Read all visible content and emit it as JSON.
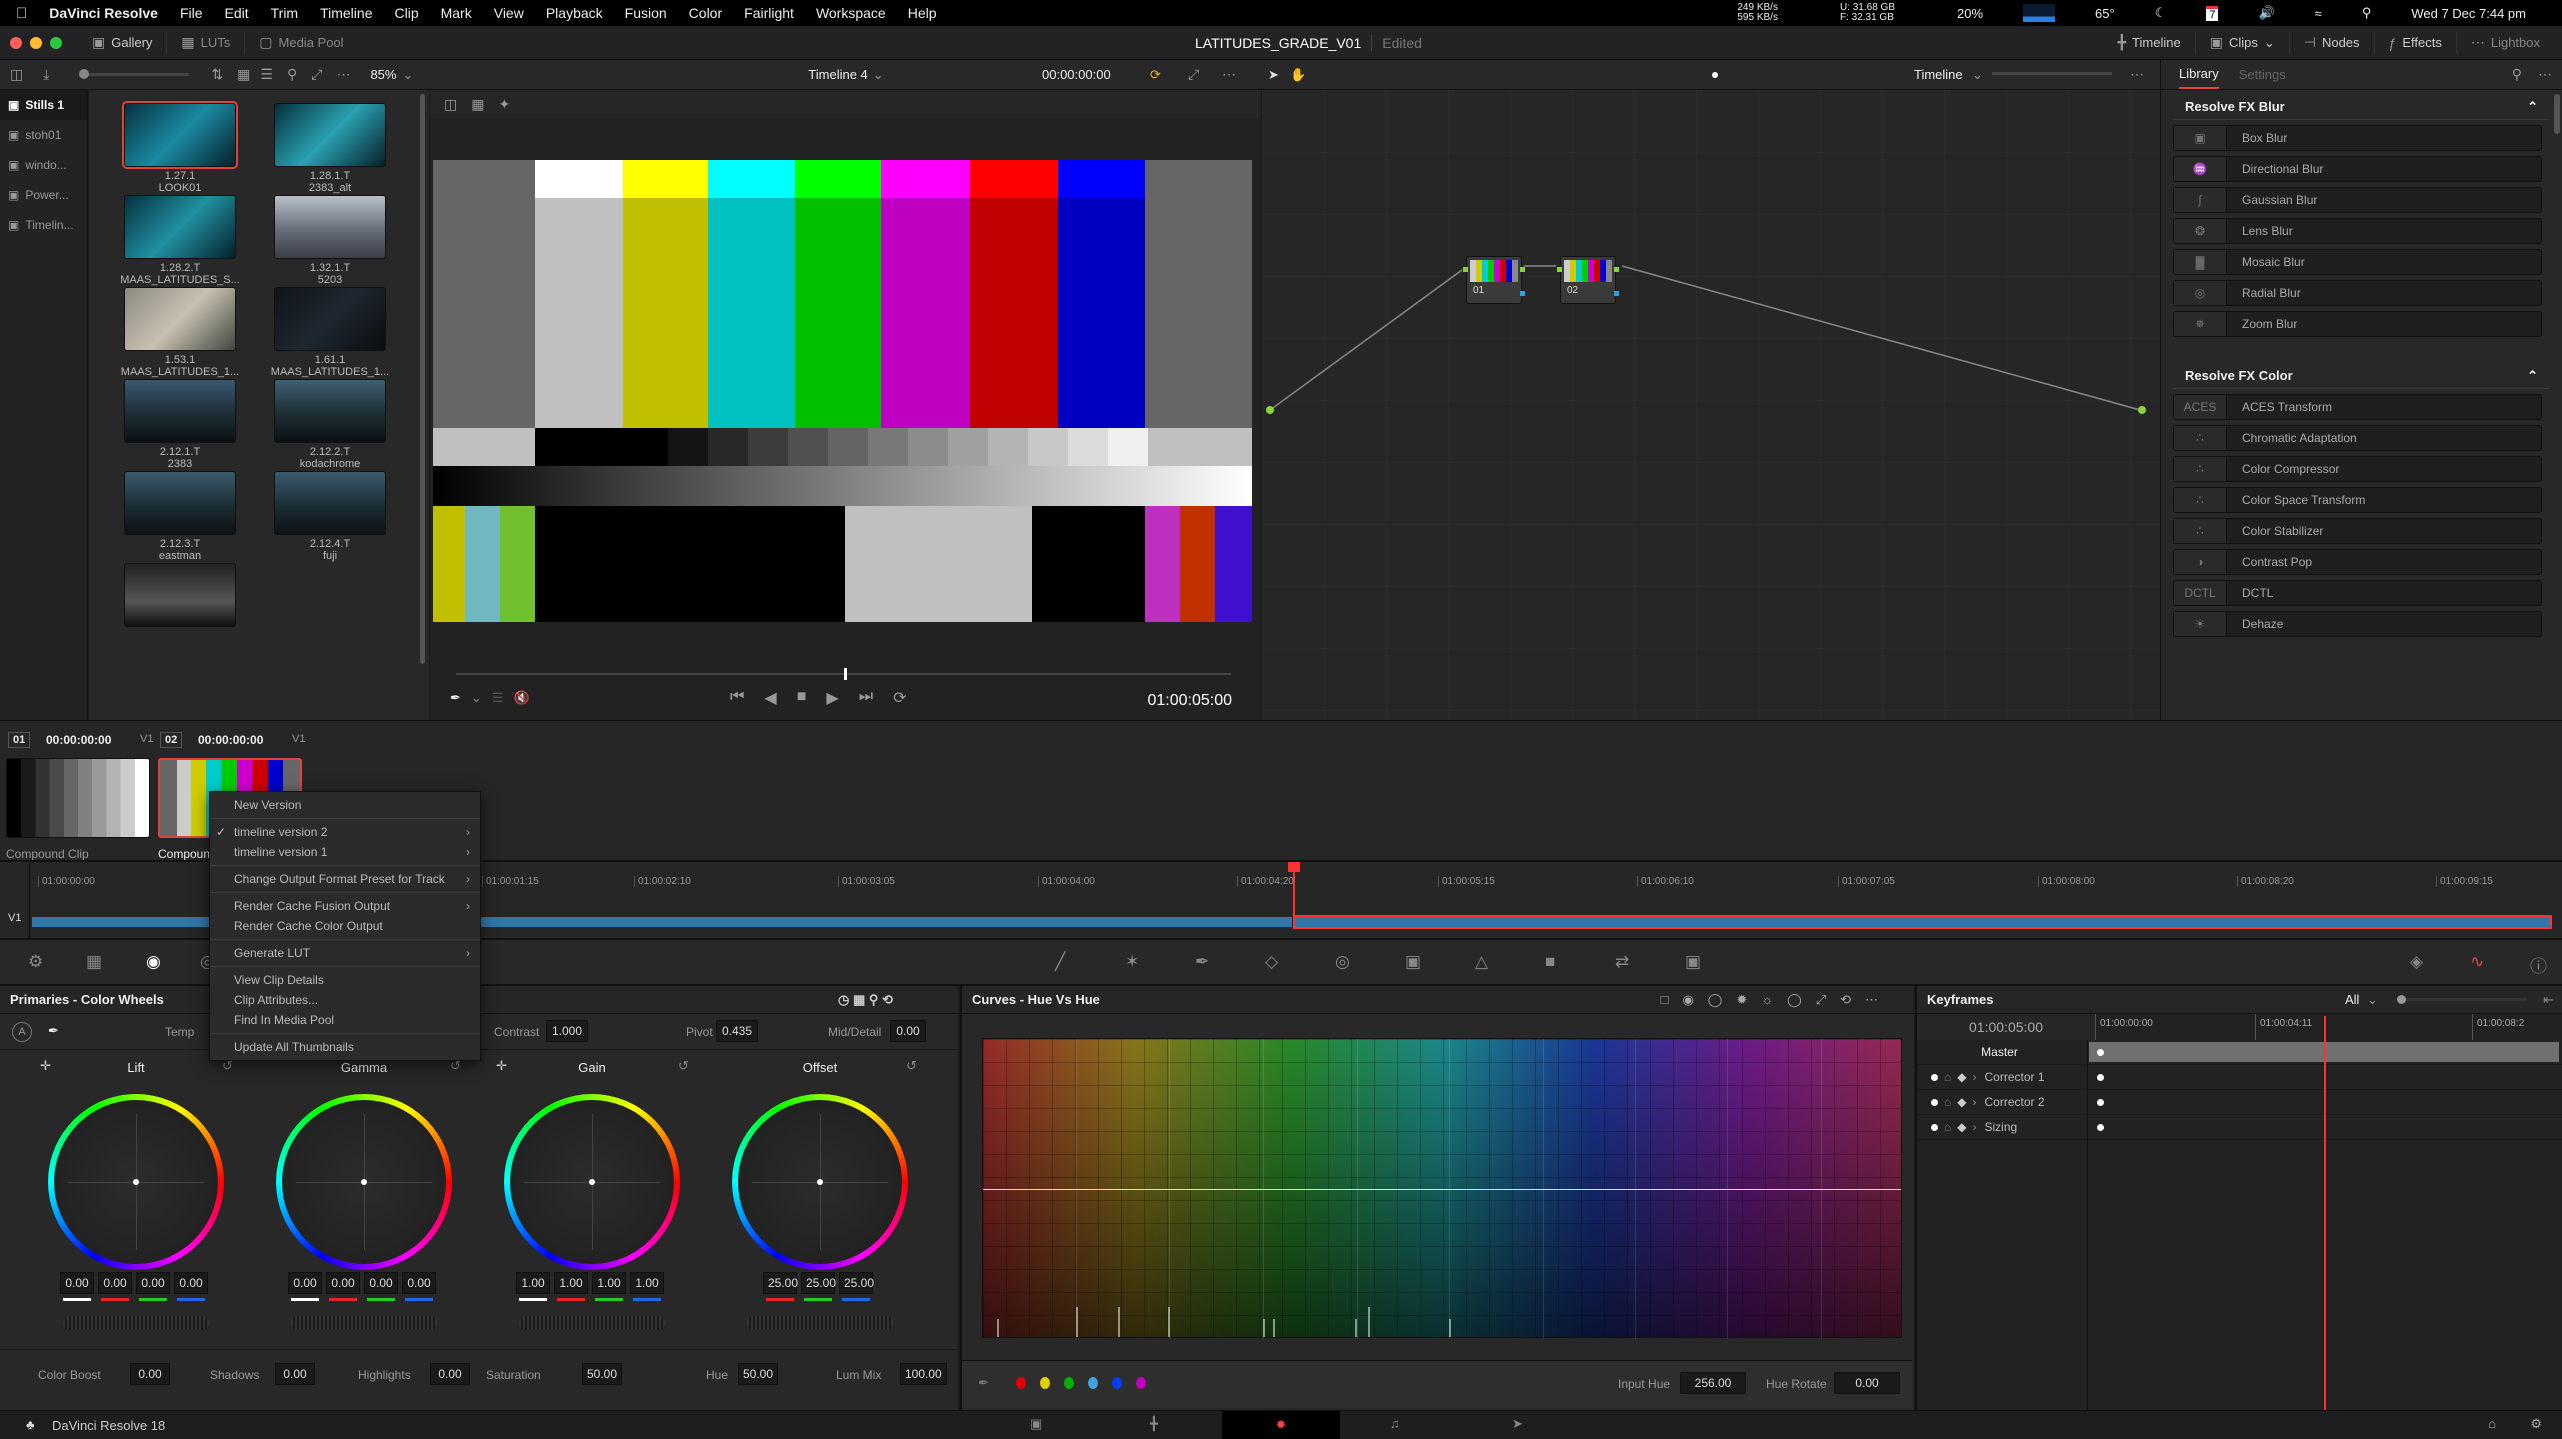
{
  "menubar": {
    "app": "DaVinci Resolve",
    "items": [
      "File",
      "Edit",
      "Trim",
      "Timeline",
      "Clip",
      "Mark",
      "View",
      "Playback",
      "Fusion",
      "Color",
      "Fairlight",
      "Workspace",
      "Help"
    ],
    "status": {
      "net_up": "249 KB/s",
      "net_down": "595 KB/s",
      "disk_u": "U: 31.68 GB",
      "disk_f": "F: 32.31 GB",
      "cpu": "20%",
      "temp": "65°",
      "calendar_day": "7",
      "datetime": "Wed 7 Dec 7:44 pm"
    }
  },
  "titlebar": {
    "project": "LATITUDES_GRADE_V01",
    "state": "Edited",
    "left_buttons": [
      "Gallery",
      "LUTs",
      "Media Pool"
    ],
    "right_buttons": [
      "Timeline",
      "Clips",
      "Nodes",
      "Effects",
      "Lightbox"
    ]
  },
  "toolbar": {
    "zoom": "85%",
    "timeline_name": "Timeline 4",
    "timecode": "00:00:00:00",
    "node_mode": "Timeline",
    "library_tabs": [
      "Library",
      "Settings"
    ]
  },
  "gallery": {
    "albums": [
      "Stills 1",
      "stoh01",
      "windo...",
      "Power...",
      "Timelin..."
    ],
    "stills": [
      {
        "id": "1.27.1",
        "name": "LOOK01",
        "selected": true
      },
      {
        "id": "1.28.1.T",
        "name": "2383_alt"
      },
      {
        "id": "1.28.2.T",
        "name": "MAAS_LATITUDES_S..."
      },
      {
        "id": "1.32.1.T",
        "name": "5203"
      },
      {
        "id": "1.53.1",
        "name": "MAAS_LATITUDES_1..."
      },
      {
        "id": "1.61.1",
        "name": "MAAS_LATITUDES_1..."
      },
      {
        "id": "2.12.1.T",
        "name": "2383"
      },
      {
        "id": "2.12.2.T",
        "name": "kodachrome"
      },
      {
        "id": "2.12.3.T",
        "name": "eastman"
      },
      {
        "id": "2.12.4.T",
        "name": "fuji"
      },
      {
        "id": "",
        "name": ""
      }
    ]
  },
  "viewer": {
    "timecode": "01:00:05:00",
    "scrub_position": 0.5
  },
  "nodes": [
    {
      "label": "01"
    },
    {
      "label": "02"
    }
  ],
  "library": {
    "sections": [
      {
        "title": "Resolve FX Blur",
        "items": [
          "Box Blur",
          "Directional Blur",
          "Gaussian Blur",
          "Lens Blur",
          "Mosaic Blur",
          "Radial Blur",
          "Zoom Blur"
        ]
      },
      {
        "title": "Resolve FX Color",
        "items": [
          "ACES Transform",
          "Chromatic Adaptation",
          "Color Compressor",
          "Color Space Transform",
          "Color Stabilizer",
          "Contrast Pop",
          "DCTL",
          "Dehaze"
        ]
      }
    ]
  },
  "clips": [
    {
      "num": "01",
      "tc": "00:00:00:00",
      "track": "V1",
      "name": "Compound Clip"
    },
    {
      "num": "02",
      "tc": "00:00:00:00",
      "track": "V1",
      "name": "Compound Clip",
      "selected": true
    }
  ],
  "context_menu": [
    {
      "label": "New Version"
    },
    {
      "sep": true
    },
    {
      "label": "timeline version 2",
      "checked": true,
      "submenu": true
    },
    {
      "label": "timeline version 1",
      "submenu": true
    },
    {
      "sep": true
    },
    {
      "label": "Change Output Format Preset for Track",
      "submenu": true
    },
    {
      "sep": true
    },
    {
      "label": "Render Cache Fusion Output",
      "submenu": true
    },
    {
      "label": "Render Cache Color Output"
    },
    {
      "sep": true
    },
    {
      "label": "Generate LUT",
      "submenu": true
    },
    {
      "sep": true
    },
    {
      "label": "View Clip Details"
    },
    {
      "label": "Clip Attributes..."
    },
    {
      "label": "Find In Media Pool"
    },
    {
      "sep": true
    },
    {
      "label": "Update All Thumbnails"
    }
  ],
  "timeline": {
    "track": "V1",
    "ruler": [
      "01:00:00:00",
      "01:00:01:15",
      "01:00:02:10",
      "01:00:03:05",
      "01:00:04:00",
      "01:00:04:20",
      "01:00:05:15",
      "01:00:06:10",
      "01:00:07:05",
      "01:00:08:00",
      "01:00:08:20",
      "01:00:09:15"
    ]
  },
  "primaries": {
    "title": "Primaries - Color Wheels",
    "temp_label": "Temp",
    "contrast_label": "Contrast",
    "contrast": "1.000",
    "pivot_label": "Pivot",
    "pivot": "0.435",
    "mid_label": "Mid/Detail",
    "mid": "0.00",
    "wheels": [
      {
        "name": "Lift",
        "values": [
          "0.00",
          "0.00",
          "0.00",
          "0.00"
        ]
      },
      {
        "name": "Gamma",
        "values": [
          "0.00",
          "0.00",
          "0.00",
          "0.00"
        ]
      },
      {
        "name": "Gain",
        "values": [
          "1.00",
          "1.00",
          "1.00",
          "1.00"
        ]
      },
      {
        "name": "Offset",
        "values": [
          "25.00",
          "25.00",
          "25.00"
        ]
      }
    ],
    "bottom": [
      {
        "label": "Color Boost",
        "value": "0.00"
      },
      {
        "label": "Shadows",
        "value": "0.00"
      },
      {
        "label": "Highlights",
        "value": "0.00"
      },
      {
        "label": "Saturation",
        "value": "50.00"
      },
      {
        "label": "Hue",
        "value": "50.00"
      },
      {
        "label": "Lum Mix",
        "value": "100.00"
      }
    ]
  },
  "curves": {
    "title": "Curves - Hue Vs Hue",
    "input_hue_label": "Input Hue",
    "input_hue": "256.00",
    "hue_rotate_label": "Hue Rotate",
    "hue_rotate": "0.00",
    "swatches": [
      "#e00000",
      "#e0d000",
      "#00b000",
      "#40a0e0",
      "#0040f0",
      "#c000c0"
    ]
  },
  "keyframes": {
    "title": "Keyframes",
    "filter": "All",
    "timecode": "01:00:05:00",
    "ruler": [
      "01:00:00:00",
      "01:00:04:11",
      "01:00:08:2"
    ],
    "rows": [
      "Master",
      "Corrector 1",
      "Corrector 2",
      "Sizing"
    ]
  },
  "footer": {
    "app_version": "DaVinci Resolve 18"
  },
  "colors": {
    "accent_red": "#e0443a",
    "clip_blue": "#2e77a8",
    "playhead": "#ff3030"
  }
}
